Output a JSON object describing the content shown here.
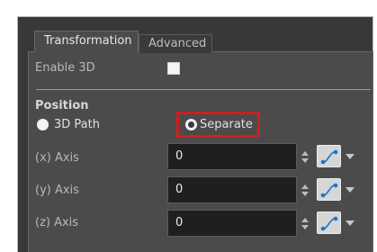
{
  "tabs": [
    {
      "label": "Transformation",
      "active": true
    },
    {
      "label": "Advanced",
      "active": false
    }
  ],
  "enable_3d": {
    "label": "Enable 3D",
    "checked": false
  },
  "position": {
    "heading": "Position",
    "options": [
      {
        "label": "3D Path",
        "selected": true
      },
      {
        "label": "Separate",
        "selected": false,
        "highlighted": true
      }
    ]
  },
  "axes": [
    {
      "label": "(x) Axis",
      "value": "0",
      "icon": "function-curve-icon"
    },
    {
      "label": "(y) Axis",
      "value": "0",
      "icon": "function-curve-icon"
    },
    {
      "label": "(z) Axis",
      "value": "0",
      "icon": "function-curve-icon"
    }
  ],
  "colors": {
    "highlight": "#cf1f1f",
    "panel": "#4b4b4b",
    "field": "#1f1f1f"
  }
}
